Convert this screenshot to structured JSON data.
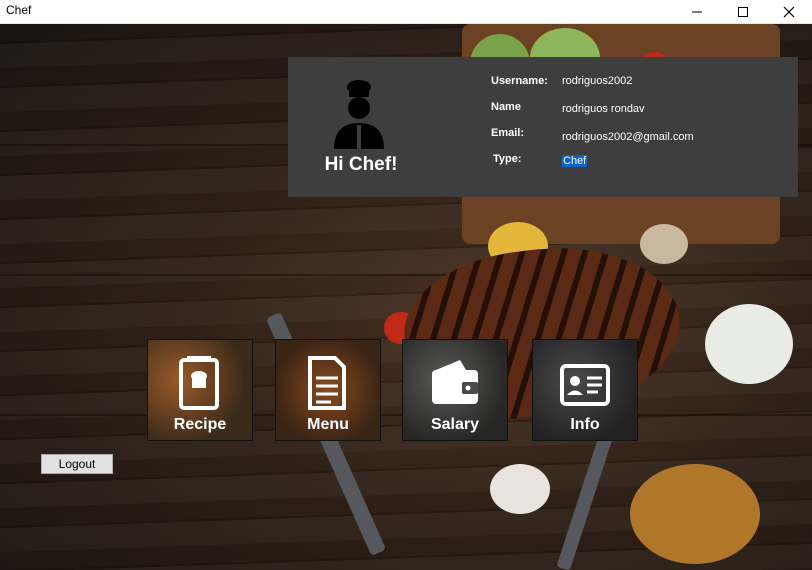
{
  "window": {
    "title": "Chef",
    "controls": [
      "minimize-icon",
      "maximize-icon",
      "close-icon"
    ]
  },
  "profile": {
    "avatar_icon": "chef-icon",
    "greeting": "Hi Chef!",
    "fields": [
      {
        "label": "Username:",
        "value": "rodriguos2002"
      },
      {
        "label": "Name",
        "value": "rodriguos rondav"
      },
      {
        "label": "Email:",
        "value": "rodriguos2002@gmail.com"
      },
      {
        "label": "Type:",
        "value": "Chef"
      }
    ]
  },
  "tiles": [
    {
      "label": "Recipe",
      "icon": "recipe-book-icon"
    },
    {
      "label": "Menu",
      "icon": "menu-document-icon"
    },
    {
      "label": "Salary",
      "icon": "wallet-icon"
    },
    {
      "label": "Info",
      "icon": "id-card-icon"
    }
  ],
  "logout_label": "Logout",
  "colors": {
    "panel": "#3e3e3e",
    "selection": "#0a64c8",
    "text": "#ffffff"
  }
}
